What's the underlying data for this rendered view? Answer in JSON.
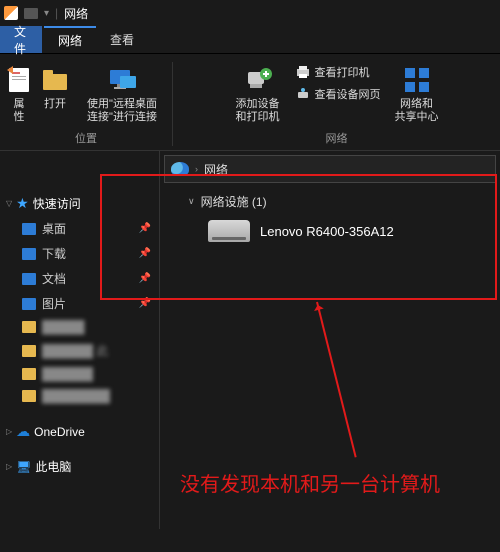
{
  "titlebar": {
    "title": "网络"
  },
  "tabs": {
    "file": "文件",
    "network": "网络",
    "view": "查看"
  },
  "ribbon": {
    "group_location": "位置",
    "group_network": "网络",
    "properties": "属\n性",
    "open": "打开",
    "remote_desktop": "使用\"远程桌面\n连接\"进行连接",
    "add_devices": "添加设备\n和打印机",
    "view_printers": "查看打印机",
    "view_device_page": "查看设备网页",
    "network_sharing": "网络和\n共享中心"
  },
  "sidebar": {
    "quick_access": "快速访问",
    "desktop": "桌面",
    "downloads": "下载",
    "documents": "文档",
    "pictures": "图片",
    "blur1": "█████",
    "blur2": "██████ 此",
    "blur3": "██████",
    "blur4": "████████",
    "onedrive": "OneDrive",
    "thispc": "此电脑"
  },
  "breadcrumb": {
    "network": "网络"
  },
  "content": {
    "group_header": "网络设施 (1)",
    "device_name": "Lenovo R6400-356A12"
  },
  "annotation": "没有发现本机和另一台计算机"
}
